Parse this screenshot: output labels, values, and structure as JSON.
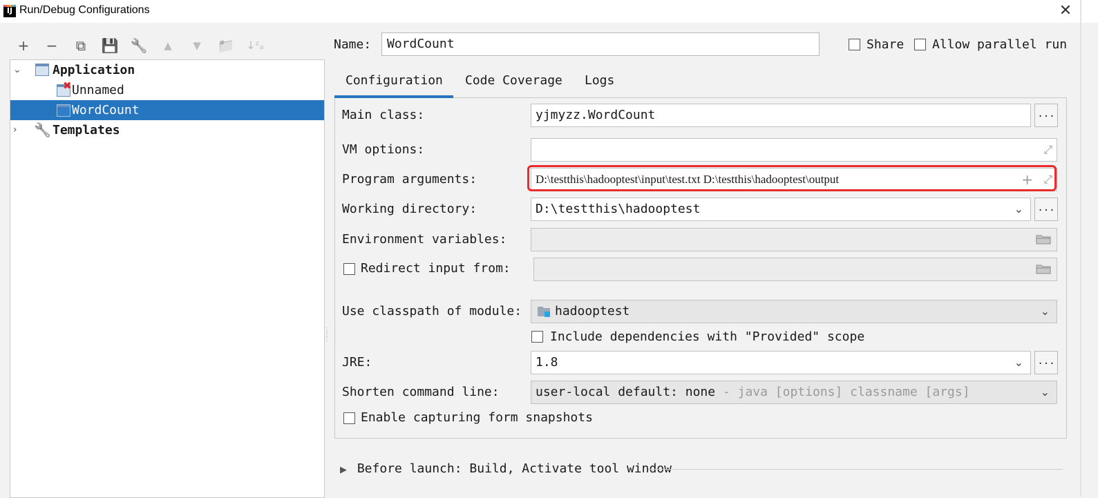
{
  "window": {
    "title": "Run/Debug Configurations",
    "icon": "IJ"
  },
  "toolbar": {
    "add": "+",
    "remove": "−",
    "copy": "⧉",
    "save": "💾",
    "edit_templates": "🔧",
    "move_up": "▲",
    "move_down": "▼",
    "new_folder": "📁",
    "sort": "↓ᶻₐ"
  },
  "tree": {
    "application": "Application",
    "unnamed": "Unnamed",
    "wordcount": "WordCount",
    "templates": "Templates"
  },
  "header": {
    "name_label": "Name:",
    "name_value": "WordCount",
    "share": "Share",
    "allow_parallel": "Allow parallel run"
  },
  "tabs": [
    "Configuration",
    "Code Coverage",
    "Logs"
  ],
  "form": {
    "main_class_label": "Main class:",
    "main_class_value": "yjmyzz.WordCount",
    "vm_options_label": "VM options:",
    "vm_options_value": "",
    "program_args_label": "Program arguments:",
    "program_args_value": "D:\\testthis\\hadooptest\\input\\test.txt D:\\testthis\\hadooptest\\output",
    "working_dir_label": "Working directory:",
    "working_dir_value": "D:\\testthis\\hadooptest",
    "env_vars_label": "Environment variables:",
    "redirect_label": "Redirect input from:",
    "classpath_label": "Use classpath of module:",
    "classpath_value": "hadooptest",
    "include_deps": "Include dependencies with \"Provided\" scope",
    "jre_label": "JRE:",
    "jre_value": "1.8",
    "shorten_label": "Shorten command line:",
    "shorten_value": "user-local default: none",
    "shorten_hint": "- java [options] classname [args]",
    "capture_label": "Enable capturing form snapshots",
    "dots": "..."
  },
  "before_launch": "Before launch: Build, Activate tool window",
  "colors": {
    "selection": "#2675bf",
    "highlight_box": "#e82b2b"
  }
}
